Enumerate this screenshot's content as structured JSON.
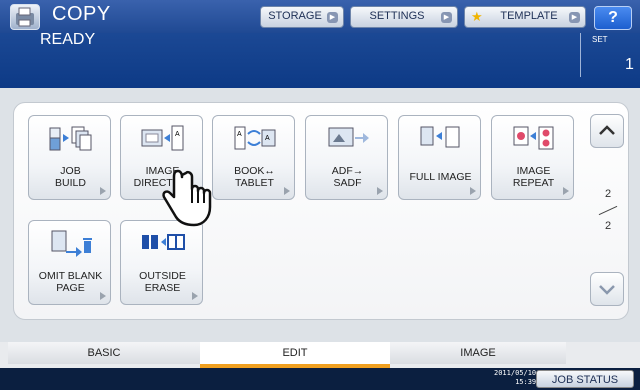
{
  "header": {
    "title": "COPY",
    "status": "READY",
    "set_label": "SET",
    "set_value": "1",
    "help_label": "?",
    "buttons": [
      {
        "label": "STORAGE"
      },
      {
        "label": "SETTINGS"
      },
      {
        "label": "TEMPLATE"
      }
    ]
  },
  "functions": [
    {
      "line1": "JOB",
      "line2": "BUILD",
      "icon": "job-build-icon"
    },
    {
      "line1": "IMAGE",
      "line2": "DIRECTION",
      "icon": "image-direction-icon"
    },
    {
      "line1": "BOOK↔",
      "line2": "TABLET",
      "icon": "book-tablet-icon"
    },
    {
      "line1": "ADF→",
      "line2": "SADF",
      "icon": "adf-sadf-icon"
    },
    {
      "line1": "FULL IMAGE",
      "line2": "",
      "icon": "full-image-icon"
    },
    {
      "line1": "IMAGE",
      "line2": "REPEAT",
      "icon": "image-repeat-icon"
    },
    {
      "line1": "OMIT BLANK",
      "line2": "PAGE",
      "icon": "omit-blank-page-icon"
    },
    {
      "line1": "OUTSIDE",
      "line2": "ERASE",
      "icon": "outside-erase-icon"
    }
  ],
  "pagination": {
    "current": "2",
    "total": "2"
  },
  "tabs": [
    {
      "label": "BASIC"
    },
    {
      "label": "EDIT"
    },
    {
      "label": "IMAGE"
    }
  ],
  "footer": {
    "date": "2011/05/10",
    "time": "15:39",
    "job_status": "JOB STATUS"
  },
  "colors": {
    "header": "#1d4a96",
    "accent_tab": "#f0a020",
    "footer": "#0b1f40"
  }
}
